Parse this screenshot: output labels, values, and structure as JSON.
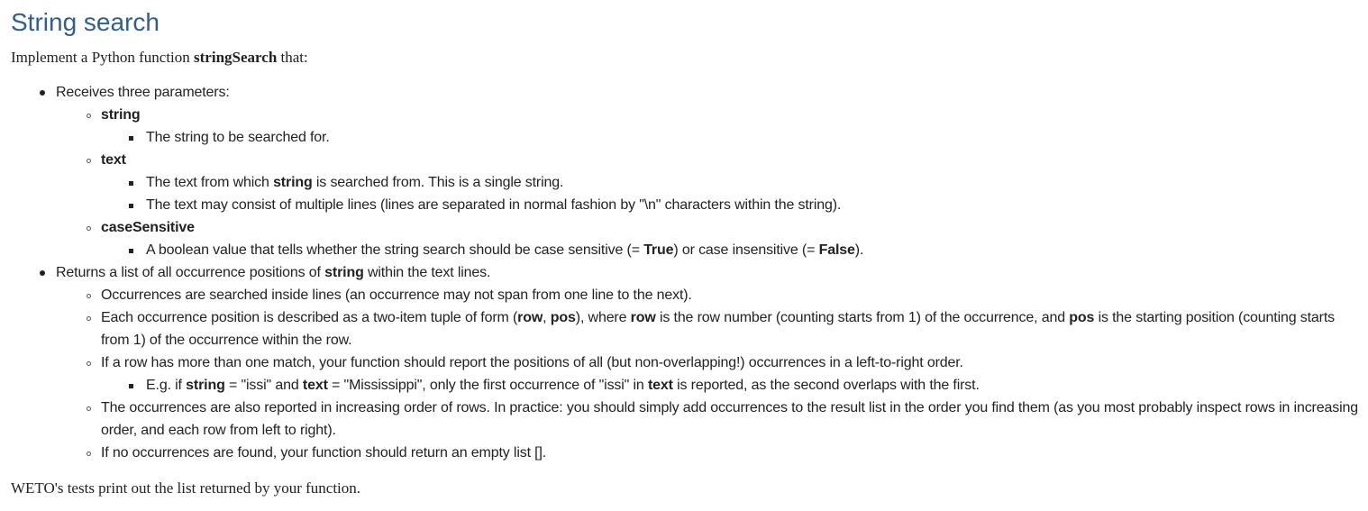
{
  "title": "String search",
  "intro": {
    "prefix": "Implement a Python function ",
    "func_name": "stringSearch",
    "suffix": " that:"
  },
  "receives": {
    "label": "Receives three parameters:",
    "params": {
      "string": {
        "name": "string",
        "desc": "The string to be searched for."
      },
      "text": {
        "name": "text",
        "desc1_pre": "The text from which ",
        "desc1_bold": "string",
        "desc1_post": " is searched from. This is a single string.",
        "desc2": "The text may consist of multiple lines (lines are separated in normal fashion by \"\\n\" characters within the string)."
      },
      "case": {
        "name": "caseSensitive",
        "desc_pre": "A boolean value that tells whether the string search should be case sensitive (= ",
        "true": "True",
        "desc_mid": ") or case insensitive (= ",
        "false": "False",
        "desc_post": ")."
      }
    }
  },
  "returns": {
    "pre": "Returns a list of all occurrence positions of ",
    "bold": "string",
    "post": " within the text lines.",
    "item1": "Occurrences are searched inside lines (an occurrence may not span from one line to the next).",
    "item2": {
      "pre": "Each occurrence position is described as a two-item tuple of form (",
      "row": "row",
      "comma": ", ",
      "pos": "pos",
      "mid1": "), where ",
      "row2": "row",
      "mid2": " is the row number (counting starts from 1) of the occurrence, and ",
      "pos2": "pos",
      "post": " is the starting position (counting starts from 1) of the occurrence within the row."
    },
    "item3": {
      "text": "If a row has more than one match, your function should report the positions of all (but non-overlapping!) occurrences in a left-to-right order.",
      "example": {
        "p1": "E.g. if ",
        "b1": "string",
        "p2": " = \"issi\" and ",
        "b2": "text",
        "p3": " = \"Mississippi\", only the first occurrence of \"issi\" in ",
        "b3": "text",
        "p4": " is reported, as the second overlaps with the first."
      }
    },
    "item4": "The occurrences are also reported in increasing order of rows. In practice: you should simply add occurrences to the result list in the order you find them (as you most probably inspect rows in increasing order, and each row from left to right).",
    "item5": "If no occurrences are found, your function should return an empty list []."
  },
  "outro": "WETO's tests print out the list returned by your function."
}
